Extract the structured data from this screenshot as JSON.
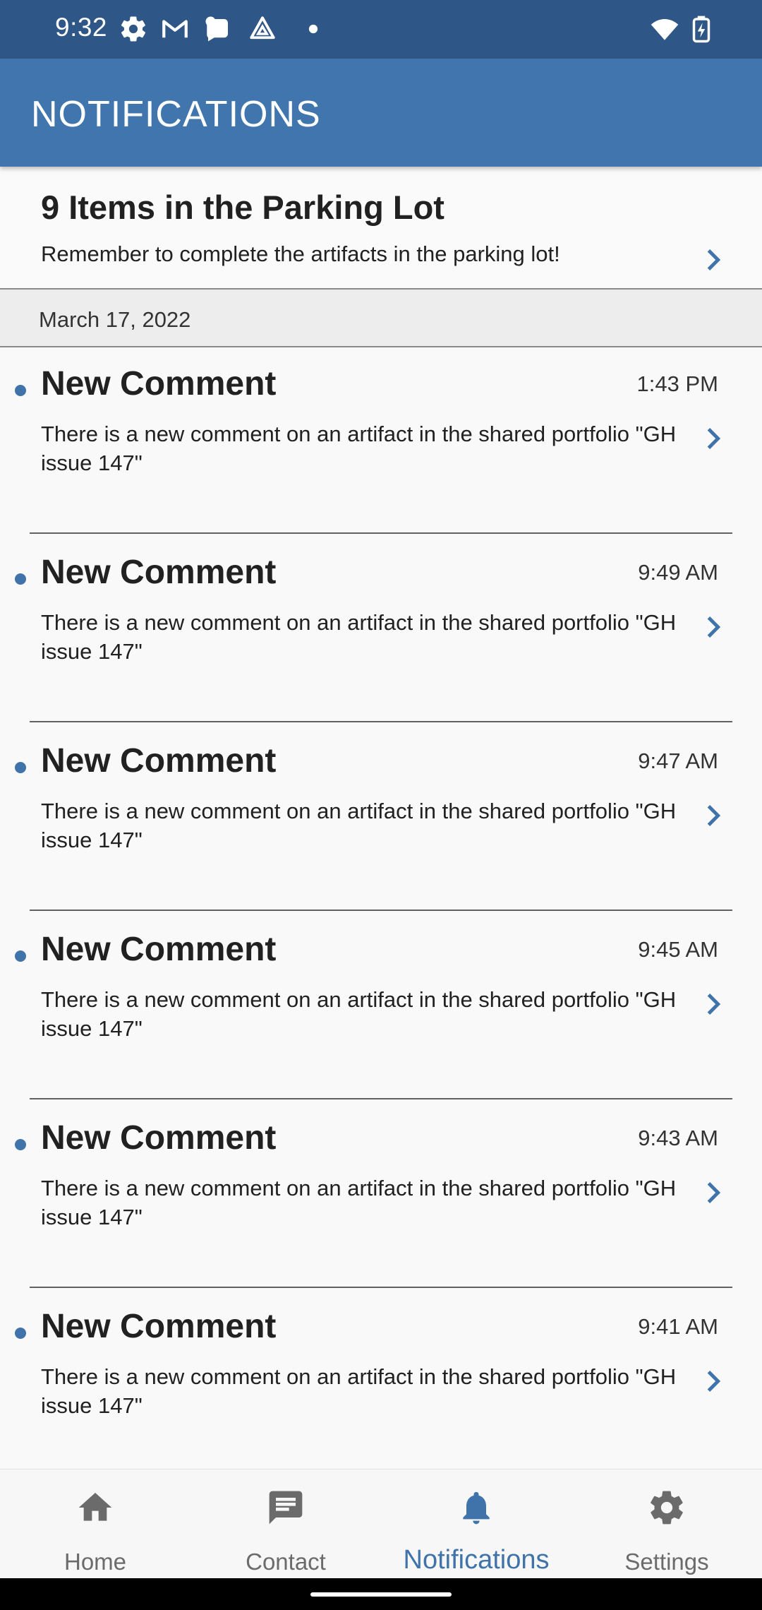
{
  "status_bar": {
    "time": "9:32",
    "icons": [
      "gear-icon",
      "gmail-icon",
      "chat-bubble-icon",
      "drive-icon",
      "dot-icon",
      "wifi-icon",
      "battery-charging-icon"
    ]
  },
  "app_bar": {
    "title": "NOTIFICATIONS"
  },
  "parking_lot": {
    "title": "9 Items in the Parking Lot",
    "message": "Remember to complete the artifacts in the parking lot!"
  },
  "date_header": "March 17, 2022",
  "notifications": [
    {
      "title": "New Comment",
      "time": "1:43 PM",
      "body": "There is a new comment on an artifact in the shared portfolio \"GH issue 147\"",
      "unread": true
    },
    {
      "title": "New Comment",
      "time": "9:49 AM",
      "body": "There is a new comment on an artifact in the shared portfolio \"GH issue 147\"",
      "unread": true
    },
    {
      "title": "New Comment",
      "time": "9:47 AM",
      "body": "There is a new comment on an artifact in the shared portfolio \"GH issue 147\"",
      "unread": true
    },
    {
      "title": "New Comment",
      "time": "9:45 AM",
      "body": "There is a new comment on an artifact in the shared portfolio \"GH issue 147\"",
      "unread": true
    },
    {
      "title": "New Comment",
      "time": "9:43 AM",
      "body": "There is a new comment on an artifact in the shared portfolio \"GH issue 147\"",
      "unread": true
    },
    {
      "title": "New Comment",
      "time": "9:41 AM",
      "body": "There is a new comment on an artifact in the shared portfolio \"GH issue 147\"",
      "unread": true
    }
  ],
  "bottom_nav": {
    "items": [
      {
        "label": "Home",
        "icon": "home-icon"
      },
      {
        "label": "Contact",
        "icon": "chat-icon"
      },
      {
        "label": "Notifications",
        "icon": "bell-icon",
        "active": true
      },
      {
        "label": "Settings",
        "icon": "gear-icon"
      }
    ]
  },
  "colors": {
    "status_bar": "#2e5686",
    "app_bar": "#4075ad",
    "accent": "#3f73aa",
    "inactive_nav": "#6b6b6b"
  }
}
